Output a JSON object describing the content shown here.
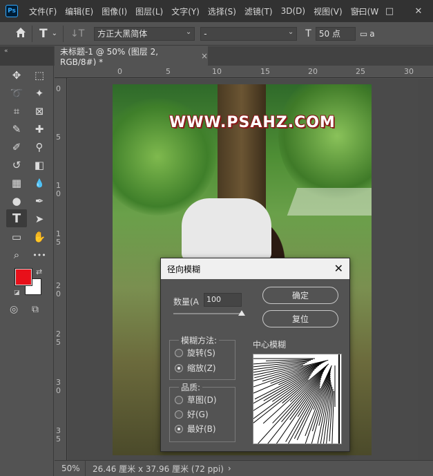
{
  "app": {
    "logo_text": "Ps",
    "menu": [
      "文件(F)",
      "编辑(E)",
      "图像(I)",
      "图层(L)",
      "文字(Y)",
      "选择(S)",
      "滤镜(T)",
      "3D(D)",
      "视图(V)",
      "窗口(W"
    ],
    "window_controls": {
      "minimize": "—",
      "restore": "□",
      "close": "✕"
    }
  },
  "options_bar": {
    "home_icon": "home-icon",
    "type_tool_glyph": "T",
    "orientation_glyph": "↓T",
    "font_family": "方正大黑简体",
    "font_style": "-",
    "size_glyph": "T",
    "font_size": "50 点",
    "aa_glyph": "a"
  },
  "document_tab": {
    "title": "未标题-1 @ 50% (图层 2, RGB/8#) *",
    "close": "×",
    "collapse_glyph": "«"
  },
  "ruler": {
    "top_ticks": [
      "0",
      "5",
      "10",
      "15",
      "20",
      "25",
      "30"
    ],
    "left_ticks": [
      "0",
      "5",
      "1 0",
      "1 5",
      "2 0",
      "2 5",
      "3 0",
      "3 5"
    ]
  },
  "toolbar": {
    "tools": [
      {
        "name": "move-tool",
        "glyph": "✥"
      },
      {
        "name": "marquee-tool",
        "glyph": "⬚"
      },
      {
        "name": "lasso-tool",
        "glyph": "➰"
      },
      {
        "name": "magic-wand-tool",
        "glyph": "✦"
      },
      {
        "name": "crop-tool",
        "glyph": "⌗"
      },
      {
        "name": "frame-tool",
        "glyph": "⊠"
      },
      {
        "name": "eyedropper-tool",
        "glyph": "✎"
      },
      {
        "name": "healing-tool",
        "glyph": "✚"
      },
      {
        "name": "brush-tool",
        "glyph": "✐"
      },
      {
        "name": "stamp-tool",
        "glyph": "⚲"
      },
      {
        "name": "history-brush-tool",
        "glyph": "↺"
      },
      {
        "name": "eraser-tool",
        "glyph": "◧"
      },
      {
        "name": "gradient-tool",
        "glyph": "▦"
      },
      {
        "name": "blur-tool",
        "glyph": "💧"
      },
      {
        "name": "dodge-tool",
        "glyph": "●"
      },
      {
        "name": "pen-tool",
        "glyph": "✒"
      },
      {
        "name": "type-tool",
        "glyph": "T"
      },
      {
        "name": "path-selection-tool",
        "glyph": "➤"
      },
      {
        "name": "rectangle-tool",
        "glyph": "▭"
      },
      {
        "name": "hand-tool",
        "glyph": "✋"
      },
      {
        "name": "zoom-tool",
        "glyph": "⌕"
      },
      {
        "name": "more-tools",
        "glyph": "•••"
      }
    ],
    "foreground_color": "#e8101a",
    "background_color": "#ffffff"
  },
  "canvas": {
    "watermark": "WWW.PSAHZ.COM"
  },
  "status": {
    "zoom": "50%",
    "doc_info": "26.46 厘米 x 37.96 厘米 (72 ppi)",
    "arrow": "›"
  },
  "dialog": {
    "title": "径向模糊",
    "close": "✕",
    "amount_label": "数量(A",
    "amount_value": "100",
    "amount_fraction": 1.0,
    "ok_label": "确定",
    "reset_label": "复位",
    "method_title": "模糊方法:",
    "methods": [
      {
        "label": "旋转(S)",
        "selected": false
      },
      {
        "label": "缩放(Z)",
        "selected": true
      }
    ],
    "quality_title": "品质:",
    "qualities": [
      {
        "label": "草图(D)",
        "selected": false
      },
      {
        "label": "好(G)",
        "selected": false
      },
      {
        "label": "最好(B)",
        "selected": true
      }
    ],
    "center_label": "中心模糊"
  }
}
